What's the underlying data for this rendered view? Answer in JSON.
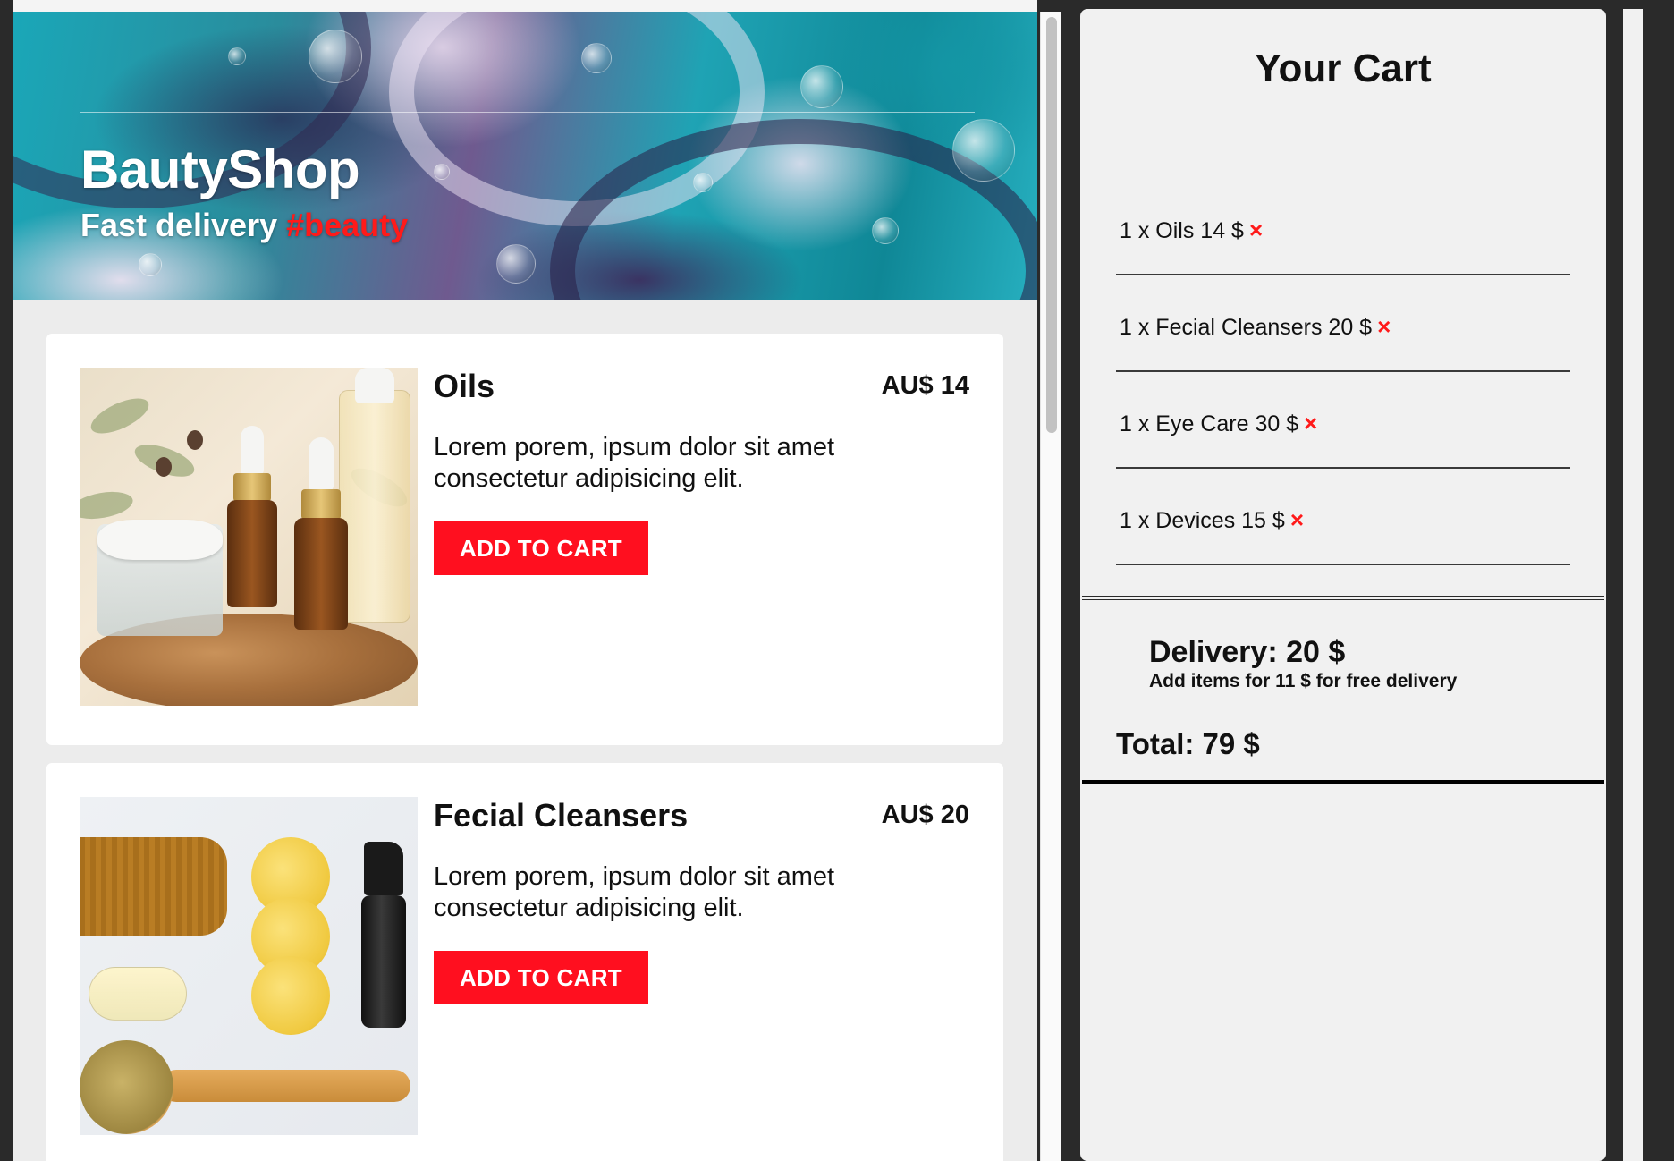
{
  "header": {
    "brand": "BautyShop",
    "tagline_main": "Fast delivery ",
    "tagline_hashtag": "#beauty"
  },
  "products": [
    {
      "name": "Oils",
      "price": "AU$ 14",
      "description": "Lorem porem, ipsum dolor sit amet consectetur adipisicing elit.",
      "button_label": "ADD TO CART"
    },
    {
      "name": "Fecial Cleansers",
      "price": "AU$ 20",
      "description": "Lorem porem, ipsum dolor sit amet consectetur adipisicing elit.",
      "button_label": "ADD TO CART"
    }
  ],
  "cart": {
    "title": "Your Cart",
    "remove_icon": "×",
    "items": [
      {
        "text": "1 x Oils 14 $"
      },
      {
        "text": "1 x Fecial Cleansers 20 $"
      },
      {
        "text": "1 x Eye Care 30 $"
      },
      {
        "text": "1 x Devices 15 $"
      }
    ],
    "delivery": "Delivery: 20 $",
    "delivery_note": "Add items for 11 $ for free delivery",
    "total": "Total: 79 $"
  },
  "colors": {
    "accent": "#ff0f1f",
    "panel_bg": "#f1f1f1",
    "page_bg": "#ececec"
  },
  "icons": [
    "remove-icon",
    "scrollbar"
  ]
}
